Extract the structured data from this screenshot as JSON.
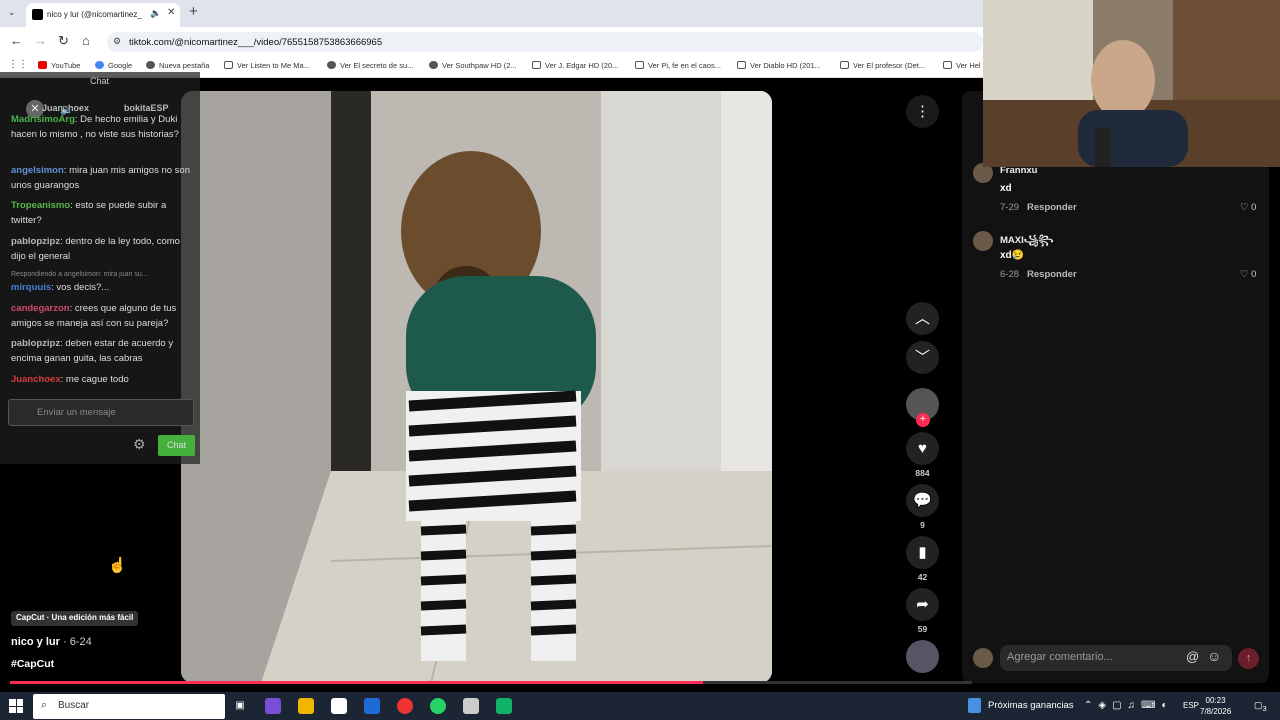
{
  "browser": {
    "tab_title": "nico y lur (@nicomartinez_",
    "url": "tiktok.com/@nicomartinez___/video/7655158753863666965",
    "bookmarks": [
      "YouTube",
      "Google",
      "Nueva pestaña",
      "Ver Listen to Me Ma...",
      "Ver El secreto de su...",
      "Ver Southpaw HD (2...",
      "Ver J. Edgar HD (20...",
      "Ver Pi, fe en el caos...",
      "Ver Diablo HD (201...",
      "Ver El profesor (Det...",
      "Ver Hel"
    ]
  },
  "chat": {
    "title": "Chat",
    "viewers": [
      "Juanchoex",
      "bokitaESP"
    ],
    "messages": [
      {
        "user": "MadrisimoArg",
        "text": "De hecho emilia y Duki hacen lo mismo , no viste sus historias?",
        "color": "#4ab34a"
      },
      {
        "user": "angelsimon",
        "text": "mira juan mis amigos no son unos guarangos",
        "color": "#5f8fd6"
      },
      {
        "user": "Tropeanismo",
        "text": "esto se puede subir a twitter?",
        "color": "#56b847"
      },
      {
        "user": "pablopzipz",
        "text": "dentro de la ley todo, como dijo el general",
        "color": "#b8b8b8"
      },
      {
        "user": "mirquuis",
        "text": "vos decis?...",
        "color": "#4a7fd6"
      },
      {
        "user": "candegarzon",
        "text": "crees que alguno de tus amigos se maneja así con su pareja?",
        "color": "#d04b68"
      },
      {
        "user": "pablopzipz",
        "text": "deben estar de acuerdo y encima ganan guita, las cabras",
        "color": "#b8b8b8"
      },
      {
        "user": "Juanchoex",
        "text": "me cague todo",
        "color": "#d63c3c"
      }
    ],
    "reply_note": "Respondiendo a angelsimon: mira juan su...",
    "input_placeholder": "Enviar un mensaje",
    "send_label": "Chat"
  },
  "video": {
    "author": "nico y lur",
    "date": "· 6-24",
    "hashtag": "#CapCut",
    "badge": "CapCut · Una edición más fácil",
    "progress": 0.72
  },
  "actions": {
    "likes": "884",
    "comments": "9",
    "saves": "42",
    "shares": "59"
  },
  "comments": [
    {
      "user": "Frannxu",
      "text": "xd",
      "date": "7-29",
      "reply": "Responder",
      "likes": "0"
    },
    {
      "user": "MAXI꧁꧂",
      "text": "xd😢",
      "date": "6-28",
      "reply": "Responder",
      "likes": "0"
    }
  ],
  "comment_input_placeholder": "Agregar comentario...",
  "taskbar": {
    "search": "Buscar",
    "news": "Próximas ganancias",
    "lang": "ESP",
    "time": "00:23",
    "date": "7/8/2026",
    "notif": "3"
  }
}
